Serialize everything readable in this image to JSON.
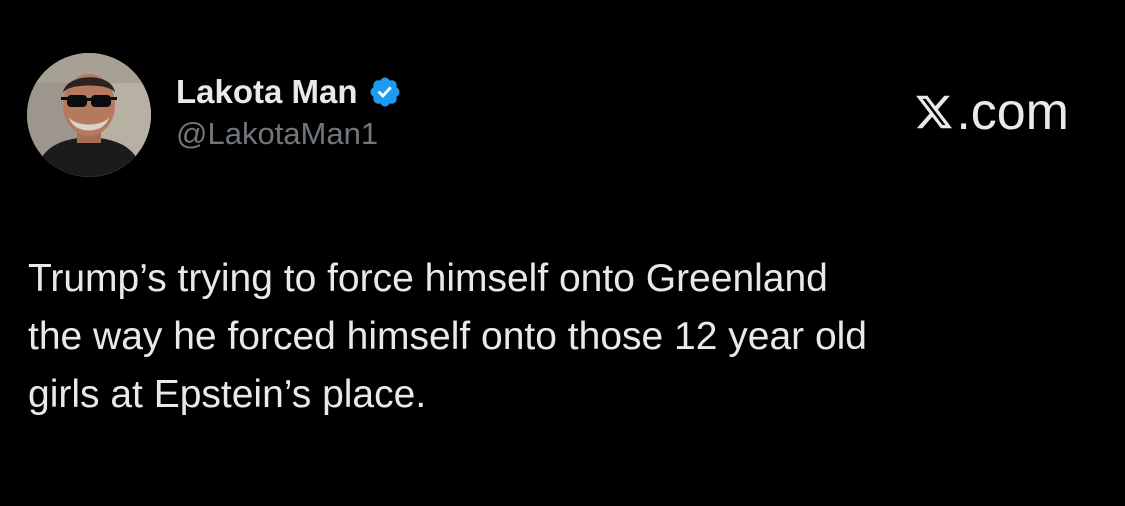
{
  "author": {
    "display_name": "Lakota Man",
    "handle": "@LakotaMan1",
    "verified": true,
    "verified_badge_color": "#1d9bf0",
    "avatar_icon": "profile-photo"
  },
  "branding": {
    "site_label": ".com",
    "logo_icon": "x-logo-icon"
  },
  "tweet": {
    "lines": [
      "Trump’s trying to force himself onto Greenland",
      "the way he forced himself onto those 12 year old",
      "girls at Epstein’s place."
    ]
  },
  "colors": {
    "background": "#000000",
    "primary_text": "#e7e9ea",
    "secondary_text": "#71767b"
  }
}
